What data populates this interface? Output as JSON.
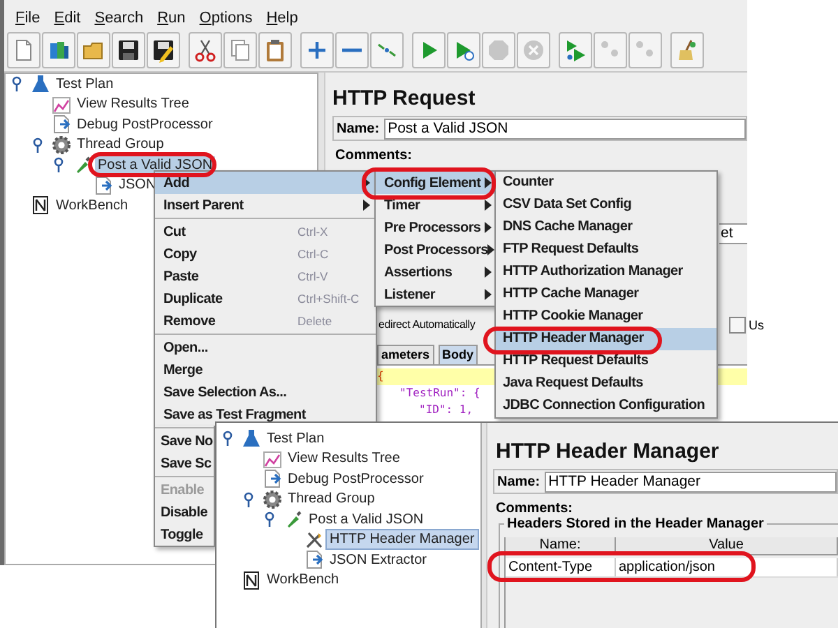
{
  "window": {
    "menu": [
      "File",
      "Edit",
      "Search",
      "Run",
      "Options",
      "Help"
    ],
    "toolbar": [
      [
        {
          "kind": "new",
          "disabled": false
        },
        {
          "kind": "templates",
          "disabled": false
        },
        {
          "kind": "open",
          "disabled": false
        },
        {
          "kind": "save",
          "disabled": false
        },
        {
          "kind": "save_as",
          "disabled": false
        }
      ],
      [
        {
          "kind": "cut",
          "disabled": false
        },
        {
          "kind": "copy",
          "disabled": false
        },
        {
          "kind": "paste",
          "disabled": false
        }
      ],
      [
        {
          "kind": "expand",
          "disabled": false
        },
        {
          "kind": "collapse",
          "disabled": false
        },
        {
          "kind": "toggle",
          "disabled": false
        }
      ],
      [
        {
          "kind": "start",
          "disabled": false
        },
        {
          "kind": "start_no_pauses",
          "disabled": false
        },
        {
          "kind": "stop",
          "disabled": true
        },
        {
          "kind": "shutdown",
          "disabled": true
        }
      ],
      [
        {
          "kind": "remote_start",
          "disabled": false
        },
        {
          "kind": "remote_stop",
          "disabled": true
        },
        {
          "kind": "remote_shutdown",
          "disabled": true
        }
      ],
      [
        {
          "kind": "clear",
          "disabled": false
        }
      ]
    ],
    "tree": [
      {
        "label": "Test Plan",
        "kind": "plan",
        "expanded": true,
        "selected": false,
        "children": [
          {
            "label": "View Results Tree",
            "kind": "listener",
            "selected": false
          },
          {
            "label": "Debug PostProcessor",
            "kind": "postprocessor",
            "selected": false
          },
          {
            "label": "Thread Group",
            "kind": "thread_group",
            "expanded": true,
            "selected": false,
            "children": [
              {
                "label": "Post a Valid JSON",
                "kind": "sampler",
                "expanded": true,
                "selected": true,
                "children": [
                  {
                    "label": "JSON",
                    "kind": "postprocessor",
                    "selected": false
                  }
                ]
              }
            ]
          }
        ]
      },
      {
        "label": "WorkBench",
        "kind": "workbench",
        "selected": false
      }
    ],
    "editor": {
      "title": "HTTP Request",
      "name_label": "Name:",
      "name_value": "Post a Valid JSON",
      "comments_label": "Comments:",
      "field_fragment": "et",
      "redirect_fragment": "edirect Automatically",
      "checkbox": {
        "label": "Us",
        "checked": false
      },
      "tabs": [
        {
          "label": "ameters",
          "selected": false
        },
        {
          "label": "Body",
          "selected": true
        }
      ],
      "code_lines": [
        "{",
        "\"TestRun\": {",
        "\"ID\": 1,"
      ]
    }
  },
  "context_menu": [
    {
      "kind": "submenu",
      "label": "Add",
      "selected": true,
      "disabled": false
    },
    {
      "kind": "submenu",
      "label": "Insert Parent",
      "selected": false,
      "disabled": false
    },
    {
      "kind": "separator"
    },
    {
      "kind": "item",
      "label": "Cut",
      "shortcut": "Ctrl-X",
      "selected": false,
      "disabled": false
    },
    {
      "kind": "item",
      "label": "Copy",
      "shortcut": "Ctrl-C",
      "selected": false,
      "disabled": false
    },
    {
      "kind": "item",
      "label": "Paste",
      "shortcut": "Ctrl-V",
      "selected": false,
      "disabled": false
    },
    {
      "kind": "item",
      "label": "Duplicate",
      "shortcut": "Ctrl+Shift-C",
      "selected": false,
      "disabled": false
    },
    {
      "kind": "item",
      "label": "Remove",
      "shortcut": "Delete",
      "selected": false,
      "disabled": false
    },
    {
      "kind": "separator"
    },
    {
      "kind": "item",
      "label": "Open...",
      "selected": false,
      "disabled": false
    },
    {
      "kind": "item",
      "label": "Merge",
      "selected": false,
      "disabled": false
    },
    {
      "kind": "item",
      "label": "Save Selection As...",
      "selected": false,
      "disabled": false
    },
    {
      "kind": "item",
      "label": "Save as Test Fragment",
      "selected": false,
      "disabled": false
    },
    {
      "kind": "separator"
    },
    {
      "kind": "item",
      "label": "Save No",
      "selected": false,
      "disabled": false
    },
    {
      "kind": "item",
      "label": "Save Sc",
      "selected": false,
      "disabled": false
    },
    {
      "kind": "separator"
    },
    {
      "kind": "item",
      "label": "Enable",
      "selected": false,
      "disabled": true
    },
    {
      "kind": "item",
      "label": "Disable",
      "selected": false,
      "disabled": false
    },
    {
      "kind": "item",
      "label": "Toggle",
      "selected": false,
      "disabled": false
    }
  ],
  "add_submenu": [
    {
      "label": "Config Element",
      "selected": true
    },
    {
      "label": "Timer",
      "selected": false
    },
    {
      "label": "Pre Processors",
      "selected": false
    },
    {
      "label": "Post Processors",
      "selected": false
    },
    {
      "label": "Assertions",
      "selected": false
    },
    {
      "label": "Listener",
      "selected": false
    }
  ],
  "config_submenu": [
    {
      "label": "Counter",
      "selected": false
    },
    {
      "label": "CSV Data Set Config",
      "selected": false
    },
    {
      "label": "DNS Cache Manager",
      "selected": false
    },
    {
      "label": "FTP Request Defaults",
      "selected": false
    },
    {
      "label": "HTTP Authorization Manager",
      "selected": false
    },
    {
      "label": "HTTP Cache Manager",
      "selected": false
    },
    {
      "label": "HTTP Cookie Manager",
      "selected": false
    },
    {
      "label": "HTTP Header Manager",
      "selected": true
    },
    {
      "label": "HTTP Request Defaults",
      "selected": false
    },
    {
      "label": "Java Request Defaults",
      "selected": false
    },
    {
      "label": "JDBC Connection Configuration",
      "selected": false
    }
  ],
  "window_2": {
    "tree": [
      {
        "label": "Test Plan",
        "kind": "plan",
        "expanded": true,
        "selected": false,
        "children": [
          {
            "label": "View Results Tree",
            "kind": "listener",
            "selected": false
          },
          {
            "label": "Debug PostProcessor",
            "kind": "postprocessor",
            "selected": false
          },
          {
            "label": "Thread Group",
            "kind": "thread_group",
            "expanded": true,
            "selected": false,
            "children": [
              {
                "label": "Post a Valid JSON",
                "kind": "sampler",
                "expanded": true,
                "selected": false,
                "children": [
                  {
                    "label": "HTTP Header Manager",
                    "kind": "config",
                    "selected": true
                  },
                  {
                    "label": "JSON Extractor",
                    "kind": "postprocessor",
                    "selected": false
                  }
                ]
              }
            ]
          }
        ]
      },
      {
        "label": "WorkBench",
        "kind": "workbench",
        "selected": false
      }
    ],
    "editor": {
      "title": "HTTP Header Manager",
      "name_label": "Name:",
      "name_value": "HTTP Header Manager",
      "comments_label": "Comments:",
      "group_title": "Headers Stored in the Header Manager",
      "table": {
        "columns": [
          "Name:",
          "Value"
        ],
        "rows": [
          [
            "Content-Type",
            "application/json"
          ]
        ]
      }
    }
  }
}
